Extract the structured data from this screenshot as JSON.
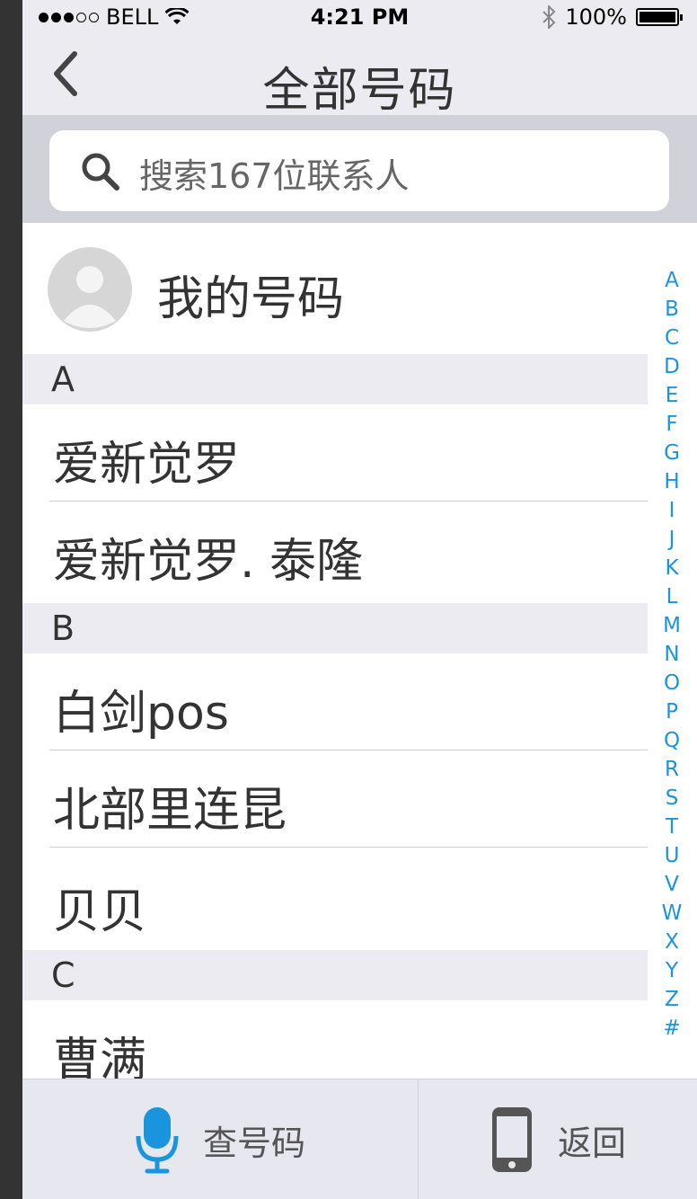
{
  "status_bar": {
    "carrier": "BELL",
    "time": "4:21 PM",
    "battery": "100%"
  },
  "nav": {
    "title": "全部号码"
  },
  "search": {
    "placeholder": "搜索167位联系人"
  },
  "my_number": {
    "label": "我的号码"
  },
  "sections": [
    {
      "letter": "A",
      "contacts": [
        "爱新觉罗",
        "爱新觉罗. 泰隆"
      ]
    },
    {
      "letter": "B",
      "contacts": [
        "白剑pos",
        "北部里连昆",
        "贝贝"
      ]
    },
    {
      "letter": "C",
      "contacts": [
        "曹满"
      ]
    }
  ],
  "index_letters": [
    "A",
    "B",
    "C",
    "D",
    "E",
    "F",
    "G",
    "H",
    "I",
    "J",
    "K",
    "L",
    "M",
    "N",
    "O",
    "P",
    "Q",
    "R",
    "S",
    "T",
    "U",
    "V",
    "W",
    "X",
    "Y",
    "Z",
    "#"
  ],
  "tabbar": {
    "search_label": "查号码",
    "back_label": "返回"
  },
  "colors": {
    "accent": "#1a95dd",
    "header_bg": "#ebebf1",
    "search_bg": "#d1d1d9",
    "tabbar_bg": "#e7e7ef",
    "text": "#333333",
    "placeholder": "#666666"
  }
}
